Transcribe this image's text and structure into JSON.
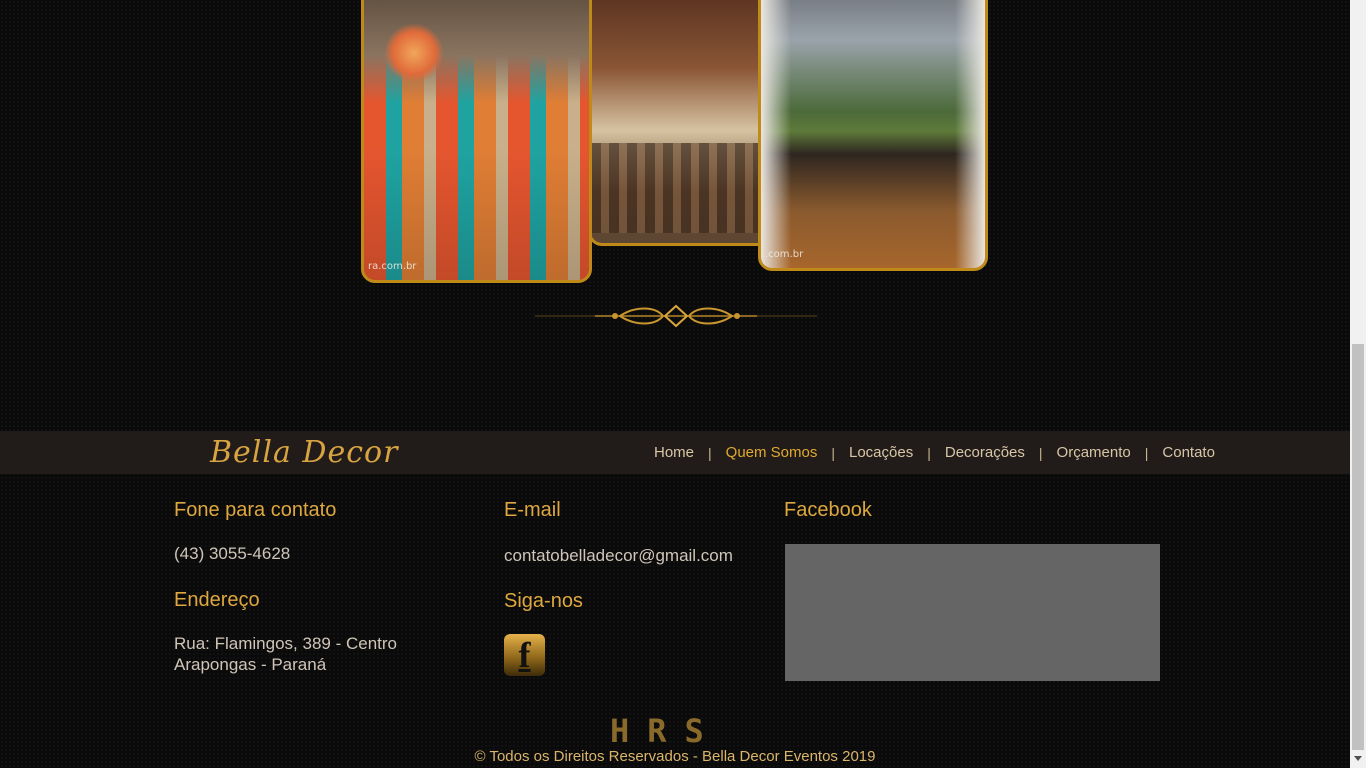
{
  "gallery": {
    "photos": [
      {
        "name": "table-setting-photo",
        "watermark": "ra.com.br"
      },
      {
        "name": "dining-hall-photo",
        "watermark": ""
      },
      {
        "name": "veranda-lounge-photo",
        "watermark": ".com.br"
      }
    ]
  },
  "brand": "Bella Decor",
  "nav": {
    "items": [
      "Home",
      "Quem Somos",
      "Locações",
      "Decorações",
      "Orçamento",
      "Contato"
    ],
    "active": "Quem Somos"
  },
  "contact": {
    "phone_title": "Fone para contato",
    "phone": "(43) 3055-4628",
    "address_title": "Endereço",
    "address_line1": "Rua: Flamingos, 389 - Centro",
    "address_line2": "Arapongas - Paraná",
    "email_title": "E-mail",
    "email": "contatobelladecor@gmail.com",
    "follow_title": "Siga-nos",
    "facebook_title": "Facebook"
  },
  "footer": {
    "developer_logo": "HRS",
    "copyright": "© Todos os Direitos Reservados - Bella Decor Eventos 2019"
  },
  "colors": {
    "gold": "#dea73f",
    "nav_bg": "#211b19",
    "page_bg": "#0a0a0a"
  }
}
